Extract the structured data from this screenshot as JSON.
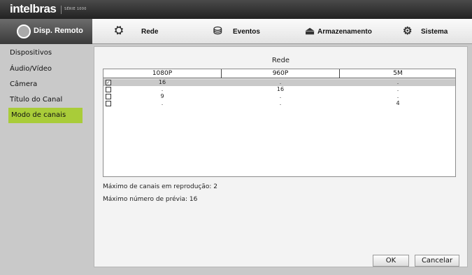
{
  "header": {
    "brand": "intelbras",
    "series": "SÉRIE 1000"
  },
  "menu": {
    "active": {
      "label": "Disp. Remoto",
      "icon": "remote-device-icon"
    },
    "items": [
      {
        "label": "Rede",
        "icon": "network-icon"
      },
      {
        "label": "Eventos",
        "icon": "events-icon"
      },
      {
        "label": "Armazenamento",
        "icon": "storage-icon"
      },
      {
        "label": "Sistema",
        "icon": "gears-icon"
      }
    ]
  },
  "sidebar": {
    "items": [
      {
        "label": "Dispositivos"
      },
      {
        "label": "Áudio/Vídeo"
      },
      {
        "label": "Câmera"
      },
      {
        "label": "Título do Canal"
      },
      {
        "label": "Modo de canais",
        "active": true
      }
    ]
  },
  "panel": {
    "title": "Rede",
    "columns": [
      "1080P",
      "960P",
      "5M"
    ],
    "rows": [
      {
        "checked": true,
        "values": [
          "16",
          ".",
          "."
        ]
      },
      {
        "checked": false,
        "values": [
          ".",
          "16",
          "."
        ]
      },
      {
        "checked": false,
        "values": [
          "9",
          ".",
          "."
        ]
      },
      {
        "checked": false,
        "values": [
          ".",
          ".",
          "4"
        ]
      }
    ],
    "info_playback": "Máximo de canais em reprodução: 2",
    "info_preview": "Máximo número de prévia: 16"
  },
  "buttons": {
    "ok": "OK",
    "cancel": "Cancelar"
  },
  "colors": {
    "accent": "#a9cc39",
    "selected_row": "#c9c9c9"
  }
}
